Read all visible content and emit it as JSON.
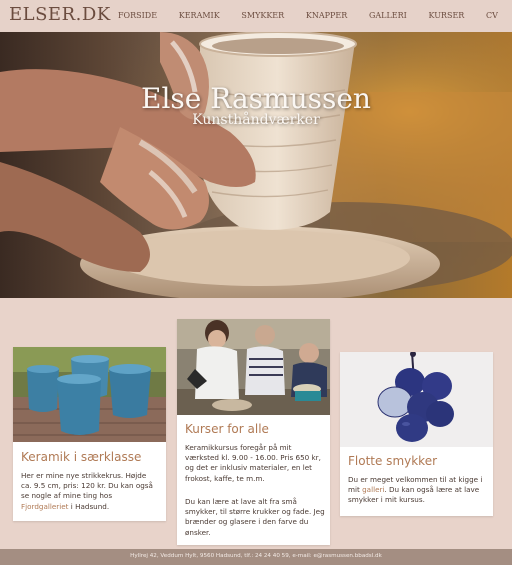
{
  "header": {
    "logo": "ELSER.DK",
    "nav": [
      "FORSIDE",
      "KERAMIK",
      "SMYKKER",
      "KNAPPER",
      "GALLERI",
      "KURSER",
      "CV"
    ]
  },
  "hero": {
    "title": "Else Rasmussen",
    "subtitle": "Kunsthåndværker"
  },
  "cards": [
    {
      "title": "Keramik i særklasse",
      "text_before": "Her er mine nye strikkekrus. Højde ca. 9.5 cm, pris: 120 kr. Du kan også se nogle af mine ting hos ",
      "link": "Fjordgalleriet",
      "text_after": " i Hadsund."
    },
    {
      "title": "Kurser for alle",
      "para1": "Keramikkursus foregår på mit værksted kl. 9.00 - 16.00. Pris 650 kr, og det er inklusiv materialer, en let frokost, kaffe, te m.m.",
      "para2": "Du kan lære at lave alt fra små smykker, til større krukker og fade. Jeg brænder og glasere i den farve du ønsker."
    },
    {
      "title": "Flotte smykker",
      "text_before": "Du er meget velkommen til at kigge i mit ",
      "link": "galleri",
      "text_after": ". Du kan også lære at lave smykker i mit kursus."
    }
  ],
  "footer": {
    "text": "Hyllrej 42, Veddum Hylt, 9560 Hadsund, tlf.: 24 24 40 59, e-mail: e@rasmussen.bbadsl.dk"
  },
  "colors": {
    "accent": "#b07a55",
    "background": "#e8d3ca",
    "footer": "#a48e82"
  }
}
